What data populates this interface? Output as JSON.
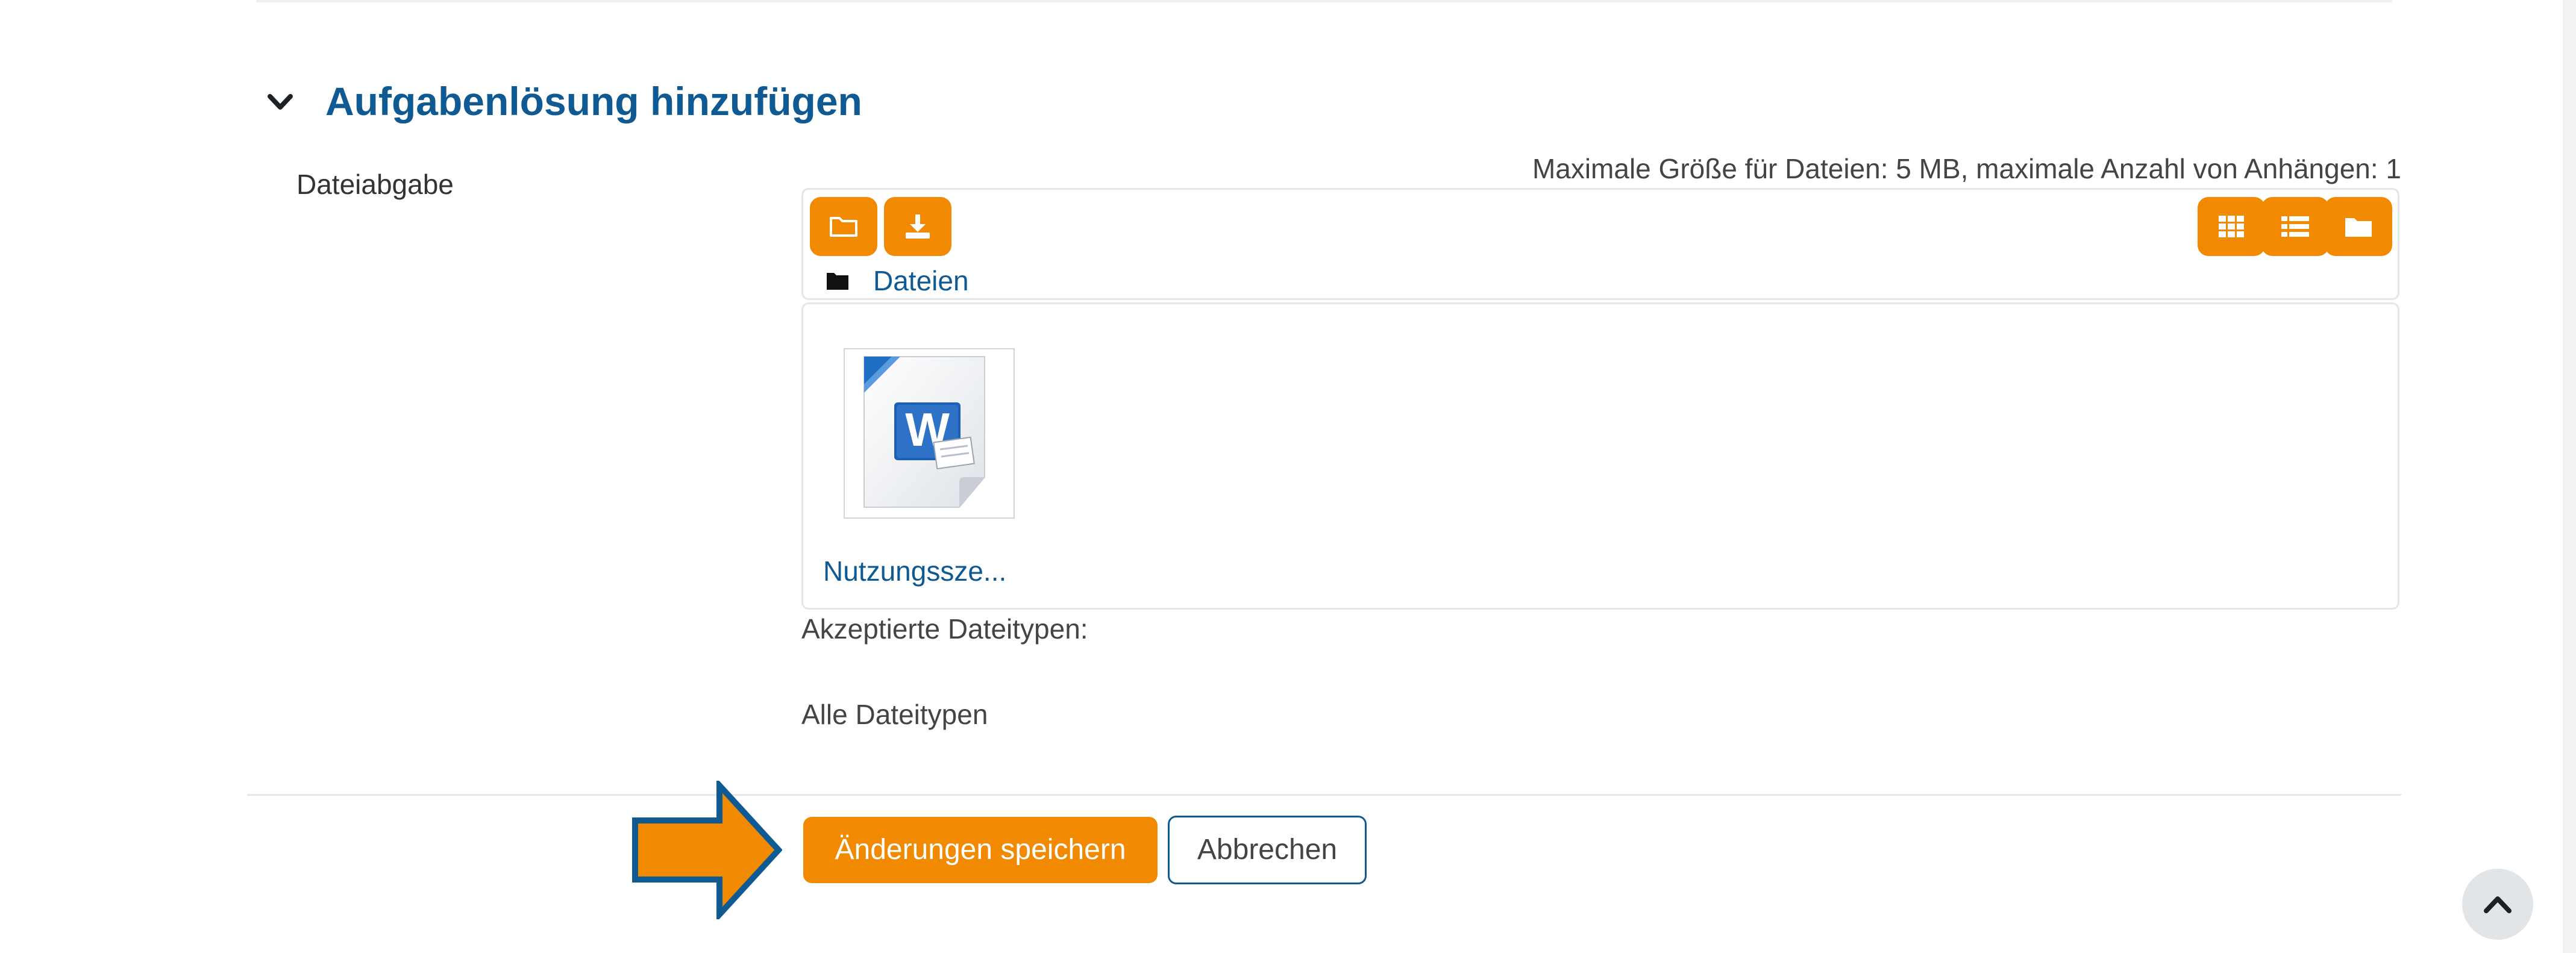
{
  "section": {
    "title": "Aufgabenlösung hinzufügen",
    "toggle_icon": "chevron-down-icon"
  },
  "field": {
    "label": "Dateiabgabe",
    "max_size_note": "Maximale Größe für Dateien: 5 MB, maximale Anzahl von Anhängen: 1"
  },
  "file_manager": {
    "toolbar_left": [
      {
        "icon": "folder-outline-icon",
        "action": "add-file"
      },
      {
        "icon": "download-icon",
        "action": "download-all"
      }
    ],
    "toolbar_right": [
      {
        "icon": "grid-icon",
        "action": "view-icons"
      },
      {
        "icon": "list-icon",
        "action": "view-details"
      },
      {
        "icon": "folder-icon",
        "action": "view-tree"
      }
    ],
    "path": {
      "icon": "folder-icon",
      "label": "Dateien"
    },
    "files": [
      {
        "name": "Nutzungssze...",
        "icon": "word-document-icon"
      }
    ]
  },
  "accepted": {
    "label": "Akzeptierte Dateitypen:",
    "value": "Alle Dateitypen"
  },
  "actions": {
    "save_label": "Änderungen speichern",
    "cancel_label": "Abbrechen"
  },
  "colors": {
    "accent": "#f18a00",
    "brand_blue": "#0f5a92",
    "border": "#e4e6e9"
  },
  "annotation": {
    "icon": "arrow-right-icon"
  },
  "scroll": {
    "icon": "chevron-up-icon"
  }
}
